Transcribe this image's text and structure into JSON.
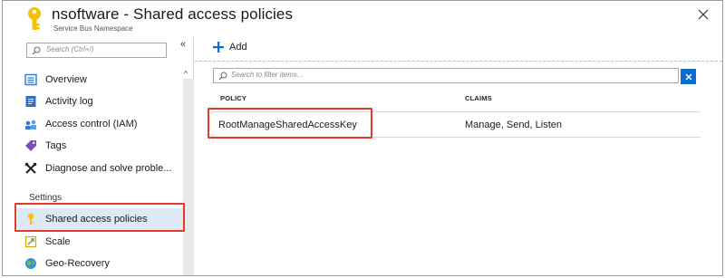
{
  "header": {
    "title": "nsoftware - Shared access policies",
    "subtitle": "Service Bus Namespace",
    "close_icon": "close-icon"
  },
  "sidebar": {
    "search_placeholder": "Search (Ctrl+/)",
    "collapse_glyph": "«",
    "scroll_up_glyph": "^",
    "items": [
      {
        "label": "Overview",
        "icon": "overview-icon"
      },
      {
        "label": "Activity log",
        "icon": "activity-log-icon"
      },
      {
        "label": "Access control (IAM)",
        "icon": "iam-icon"
      },
      {
        "label": "Tags",
        "icon": "tag-icon"
      },
      {
        "label": "Diagnose and solve proble...",
        "icon": "wrench-icon"
      }
    ],
    "section_label": "Settings",
    "settings_items": [
      {
        "label": "Shared access policies",
        "icon": "key-icon",
        "active": true
      },
      {
        "label": "Scale",
        "icon": "scale-icon"
      },
      {
        "label": "Geo-Recovery",
        "icon": "globe-icon"
      }
    ]
  },
  "main": {
    "add_label": "Add",
    "filter_placeholder": "Search to filter items...",
    "columns": [
      "POLICY",
      "CLAIMS"
    ],
    "rows": [
      {
        "policy": "RootManageSharedAccessKey",
        "claims": "Manage, Send, Listen"
      }
    ]
  },
  "colors": {
    "accent": "#0a6ed1",
    "highlight_box": "#e23b2b",
    "key_gold": "#f5c20b",
    "active_bg": "#dde9f6"
  }
}
